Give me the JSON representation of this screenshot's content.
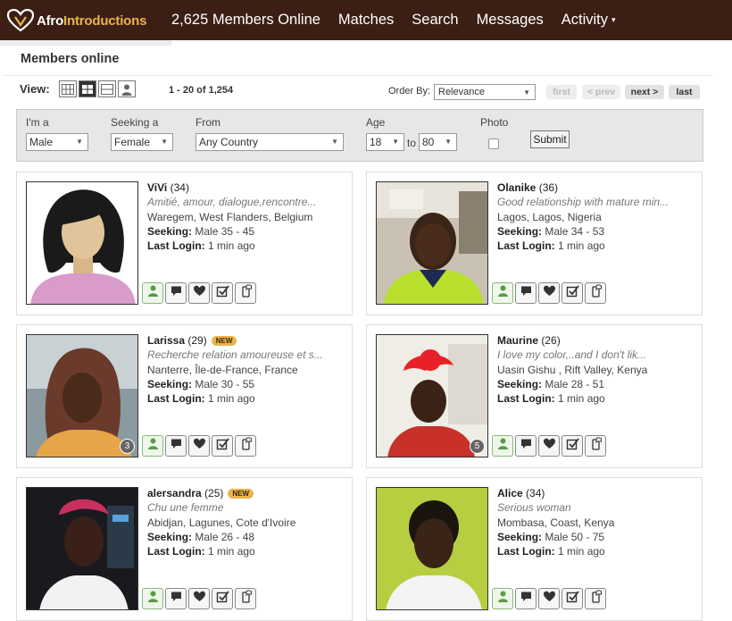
{
  "brand": {
    "name_part1": "Afro",
    "name_part2": "Introductions",
    "accent": "#e8b54a",
    "bar_color": "#3b1f15"
  },
  "nav": {
    "online": "2,625 Members Online",
    "matches": "Matches",
    "search": "Search",
    "messages": "Messages",
    "activity": "Activity",
    "activity_caret": "▾"
  },
  "section": {
    "title": "Members online"
  },
  "view": {
    "label": "View:",
    "range": "1 - 20 of 1,254"
  },
  "order": {
    "label": "Order By:",
    "selected": "Relevance"
  },
  "pager": {
    "first": "first",
    "prev": "< prev",
    "next": "next >",
    "last": "last"
  },
  "filter": {
    "im_a_label": "I'm a",
    "im_a_value": "Male",
    "seeking_label": "Seeking a",
    "seeking_value": "Female",
    "from_label": "From",
    "from_value": "Any Country",
    "age_label": "Age",
    "age_min": "18",
    "age_to": "to",
    "age_max": "80",
    "photo_label": "Photo",
    "submit": "Submit"
  },
  "members": [
    {
      "name": "ViVi",
      "age": "(34)",
      "is_new": false,
      "new_label": "",
      "tagline": "Amitié, amour, dialogue,rencontre...",
      "location": "Waregem, West Flanders, Belgium",
      "seeking_label": "Seeking:",
      "seeking": "Male 35 - 45",
      "login_label": "Last Login:",
      "login": "1 min ago",
      "photo_count": "",
      "photo_kind": "placeholder"
    },
    {
      "name": "Olanike",
      "age": "(36)",
      "is_new": false,
      "new_label": "",
      "tagline": "Good relationship with mature min...",
      "location": "Lagos, Lagos, Nigeria",
      "seeking_label": "Seeking:",
      "seeking": "Male 34 - 53",
      "login_label": "Last Login:",
      "login": "1 min ago",
      "photo_count": "",
      "photo_kind": "photo"
    },
    {
      "name": "Larissa",
      "age": "(29)",
      "is_new": true,
      "new_label": "NEW",
      "tagline": "Recherche relation amoureuse et s...",
      "location": "Nanterre, Île-de-France, France",
      "seeking_label": "Seeking:",
      "seeking": "Male 30 - 55",
      "login_label": "Last Login:",
      "login": "1 min ago",
      "photo_count": "3",
      "photo_kind": "photo"
    },
    {
      "name": "Maurine",
      "age": "(26)",
      "is_new": false,
      "new_label": "",
      "tagline": "I love my color,..and I don't lik...",
      "location": "Uasin Gishu , Rift Valley, Kenya",
      "seeking_label": "Seeking:",
      "seeking": "Male 28 - 51",
      "login_label": "Last Login:",
      "login": "1 min ago",
      "photo_count": "5",
      "photo_kind": "photo"
    },
    {
      "name": "alersandra",
      "age": "(25)",
      "is_new": true,
      "new_label": "NEW",
      "tagline": "Chu une femme",
      "location": "Abidjan, Lagunes, Cote d'Ivoire",
      "seeking_label": "Seeking:",
      "seeking": "Male 26 - 48",
      "login_label": "Last Login:",
      "login": "1 min ago",
      "photo_count": "",
      "photo_kind": "photo"
    },
    {
      "name": "Alice",
      "age": "(34)",
      "is_new": false,
      "new_label": "",
      "tagline": "Serious woman",
      "location": "Mombasa, Coast, Kenya",
      "seeking_label": "Seeking:",
      "seeking": "Male 50 - 75",
      "login_label": "Last Login:",
      "login": "1 min ago",
      "photo_count": "",
      "photo_kind": "photo"
    }
  ]
}
